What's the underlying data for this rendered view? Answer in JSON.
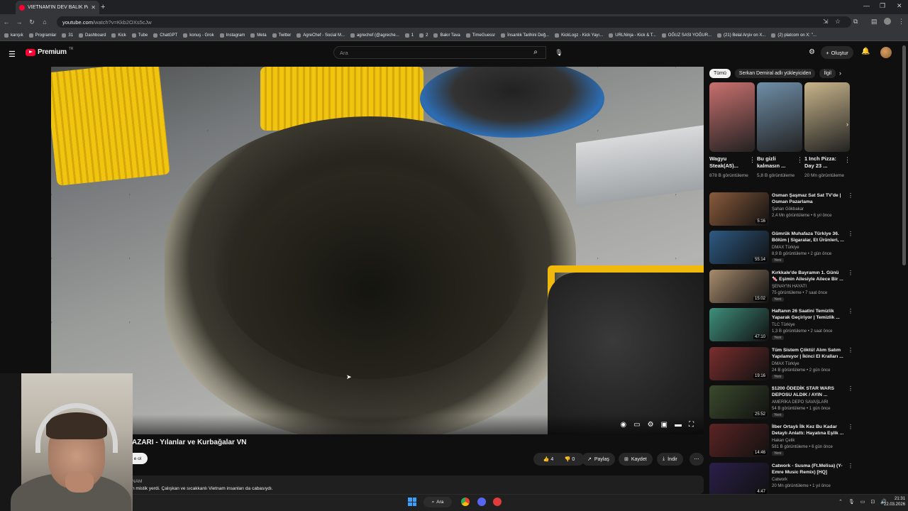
{
  "browser": {
    "tab_title": "VIETNAM'IN DEV BALIK PAZ",
    "url_host": "youtube.com",
    "url_path": "/watch?v=Kkb2OXs5cJw",
    "bookmarks": [
      "karışık",
      "Programlar",
      "31",
      "Dashboard",
      "Kick",
      "Tube",
      "ChatGPT",
      "konuş - Grok",
      "Instagram",
      "Meta",
      "Twitter",
      "AgreChef - Social M...",
      "agrechef (@agreche...",
      "1",
      "2",
      "Bakır Tava",
      "TimeGuessr",
      "İnsanlık Tarihini Değ...",
      "KickLogz - Kick Yayı...",
      "URLNinja - Kick & T...",
      "OĞUZ SASI YOĞUR...",
      "(21) Belal Arşiv on X...",
      "(2) platcom on X: \"..."
    ]
  },
  "youtube": {
    "logo_text": "Premium",
    "logo_sup": "TR",
    "search_placeholder": "Ara",
    "create_label": "Oluştur"
  },
  "video": {
    "title": "AZARI - Yılanlar ve Kurbağalar VN",
    "subscribe_label": "e ol",
    "likes": "4",
    "dislikes": "0",
    "share_label": "Paylaş",
    "save_label": "Kaydet",
    "download_label": "İndir",
    "desc_channel": "NAM",
    "desc_text": "n mistik yerdi. Çalışkan ve sıcakkanlı Vietnam insanları da cabasıydı."
  },
  "sidebar": {
    "chips": [
      "Tümü",
      "Serkan Demiral adlı yükleyiciden",
      "İlgil"
    ],
    "shorts": [
      {
        "title": "Wagyu Steak(A5)...",
        "views": "878 B görüntüleme",
        "color": "#c9706e"
      },
      {
        "title": "Bu gizli kalmasın ...",
        "views": "5,8 B görüntüleme",
        "color": "#6f8ea8"
      },
      {
        "title": "1 Inch Pizza: Day 23 ...",
        "views": "20 Mn görüntüleme",
        "color": "#c8b58a"
      }
    ],
    "recommended": [
      {
        "title": "Osman Şaşmaz Sat Sat TV'de | Osman Pazarlama",
        "channel": "Şahan Gökbakar",
        "meta": "2,4 Mn görüntüleme • 6 yıl önce",
        "duration": "5:16",
        "badge": "",
        "color": "#8a5b3c"
      },
      {
        "title": "Gümrük Muhafaza Türkiye 36. Bölüm | Sigaralar, Et Ürünleri, ...",
        "channel": "DMAX Türkiye",
        "meta": "8,9 B görüntüleme • 2 gün önce",
        "duration": "55:14",
        "badge": "Yeni",
        "color": "#2e5a83"
      },
      {
        "title": "Kırkkale'de Bayramın 1. Günü 🍬 Eşimin Ailesiyle Ailece Bir ...",
        "channel": "ŞENAY'IN HAYATI",
        "meta": "75 görüntüleme • 7 saat önce",
        "duration": "15:02",
        "badge": "Yeni",
        "color": "#a88c6e"
      },
      {
        "title": "Haftanın 26 Saatini Temizlik Yaparak Geçiriyor | Temizlik ...",
        "channel": "TLC Türkiye",
        "meta": "1,3 B görüntüleme • 2 saat önce",
        "duration": "47:10",
        "badge": "Yeni",
        "color": "#3f8f7c"
      },
      {
        "title": "Tüm Sistem Çöktü! Alım Satım Yapılamıyor | İkinci El Kralları ...",
        "channel": "DMAX Türkiye",
        "meta": "24 B görüntüleme • 2 gün önce",
        "duration": "19:16",
        "badge": "Yeni",
        "color": "#7a2e2e"
      },
      {
        "title": "$1200 ÖDEDİK STAR WARS DEPOSU ALDIK / AYIN ...",
        "channel": "AMERİKA DEPO SAVAŞLARI",
        "meta": "54 B görüntüleme • 1 gün önce",
        "duration": "25:52",
        "badge": "Yeni",
        "color": "#3b4a2c"
      },
      {
        "title": "İlber Ortaylı İlk Kez Bu Kadar Detaylı Anlattı: Hayatına Eşlik ...",
        "channel": "Hakan Çelik",
        "meta": "581 B görüntüleme • 6 gün önce",
        "duration": "14:46",
        "badge": "Yeni",
        "color": "#5c2424"
      },
      {
        "title": "Catwork - Susma (Ft.Melisa) (Y-Emre Music Remix) [HQ]",
        "channel": "Catwork",
        "meta": "20 Mn görüntüleme • 1 yıl önce",
        "duration": "4:47",
        "badge": "",
        "color": "#2a1f4a"
      }
    ]
  },
  "taskbar": {
    "search_label": "Ara",
    "time": "21:31",
    "date": "22.03.2026"
  }
}
